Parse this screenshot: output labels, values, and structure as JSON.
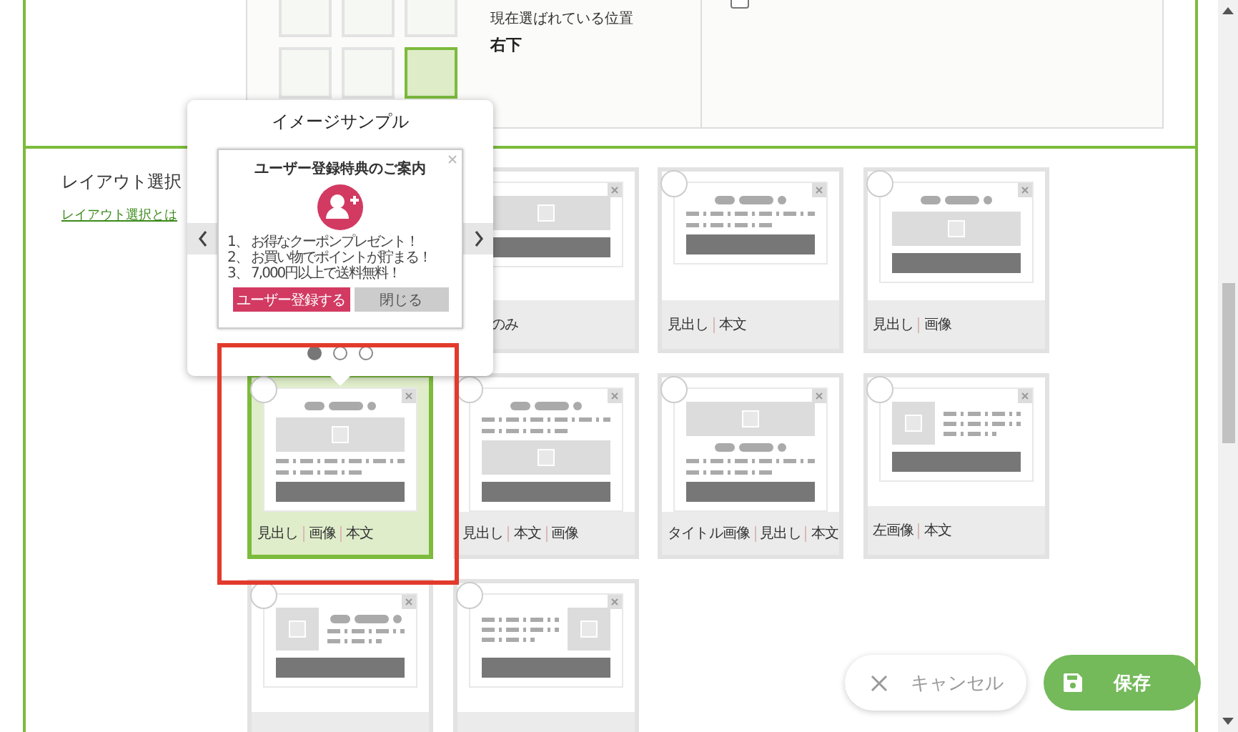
{
  "position_setting": {
    "cells": [
      {
        "selected": false
      },
      {
        "selected": false
      },
      {
        "selected": false
      },
      {
        "selected": false
      },
      {
        "selected": false
      },
      {
        "selected": true
      }
    ],
    "current_label": "現在選ばれている位置",
    "current_value": "右下",
    "modal_checkbox": {
      "checked": false
    }
  },
  "layout_section": {
    "title": "レイアウト選択",
    "help_link": "レイアウト選択とは",
    "layouts": [
      {
        "kind": "image",
        "label": [
          "のみ"
        ],
        "selected": false
      },
      {
        "kind": "heading_text",
        "label": [
          "見出し",
          "本文"
        ],
        "selected": false
      },
      {
        "kind": "heading_image",
        "label": [
          "見出し",
          "画像"
        ],
        "selected": false
      },
      {
        "kind": "heading_image_text",
        "label": [
          "見出し",
          "画像",
          "本文"
        ],
        "selected": true
      },
      {
        "kind": "heading_text_image",
        "label": [
          "見出し",
          "本文",
          "画像"
        ],
        "selected": false
      },
      {
        "kind": "title_image",
        "label": [
          "タイトル画像",
          "見出し",
          "本文"
        ],
        "selected": false
      },
      {
        "kind": "left_image",
        "label": [
          "左画像",
          "本文"
        ],
        "selected": false
      },
      {
        "kind": "left_image_heading",
        "selected": false
      },
      {
        "kind": "right_image",
        "selected": false
      }
    ]
  },
  "preview_popup": {
    "title": "イメージサンプル",
    "sample": {
      "title": "ユーザー登録特典のご案内",
      "items": [
        "1、 お得なクーポンプレゼント！",
        "2、 お買い物でポイントが貯まる！",
        "3、 7,000円以上で送料無料！"
      ],
      "primary_button": "ユーザー登録する",
      "secondary_button": "閉じる"
    },
    "pages": [
      {
        "selected": true
      },
      {
        "selected": false
      },
      {
        "selected": false
      }
    ]
  },
  "actions": {
    "cancel": "キャンセル",
    "save": "保存"
  }
}
